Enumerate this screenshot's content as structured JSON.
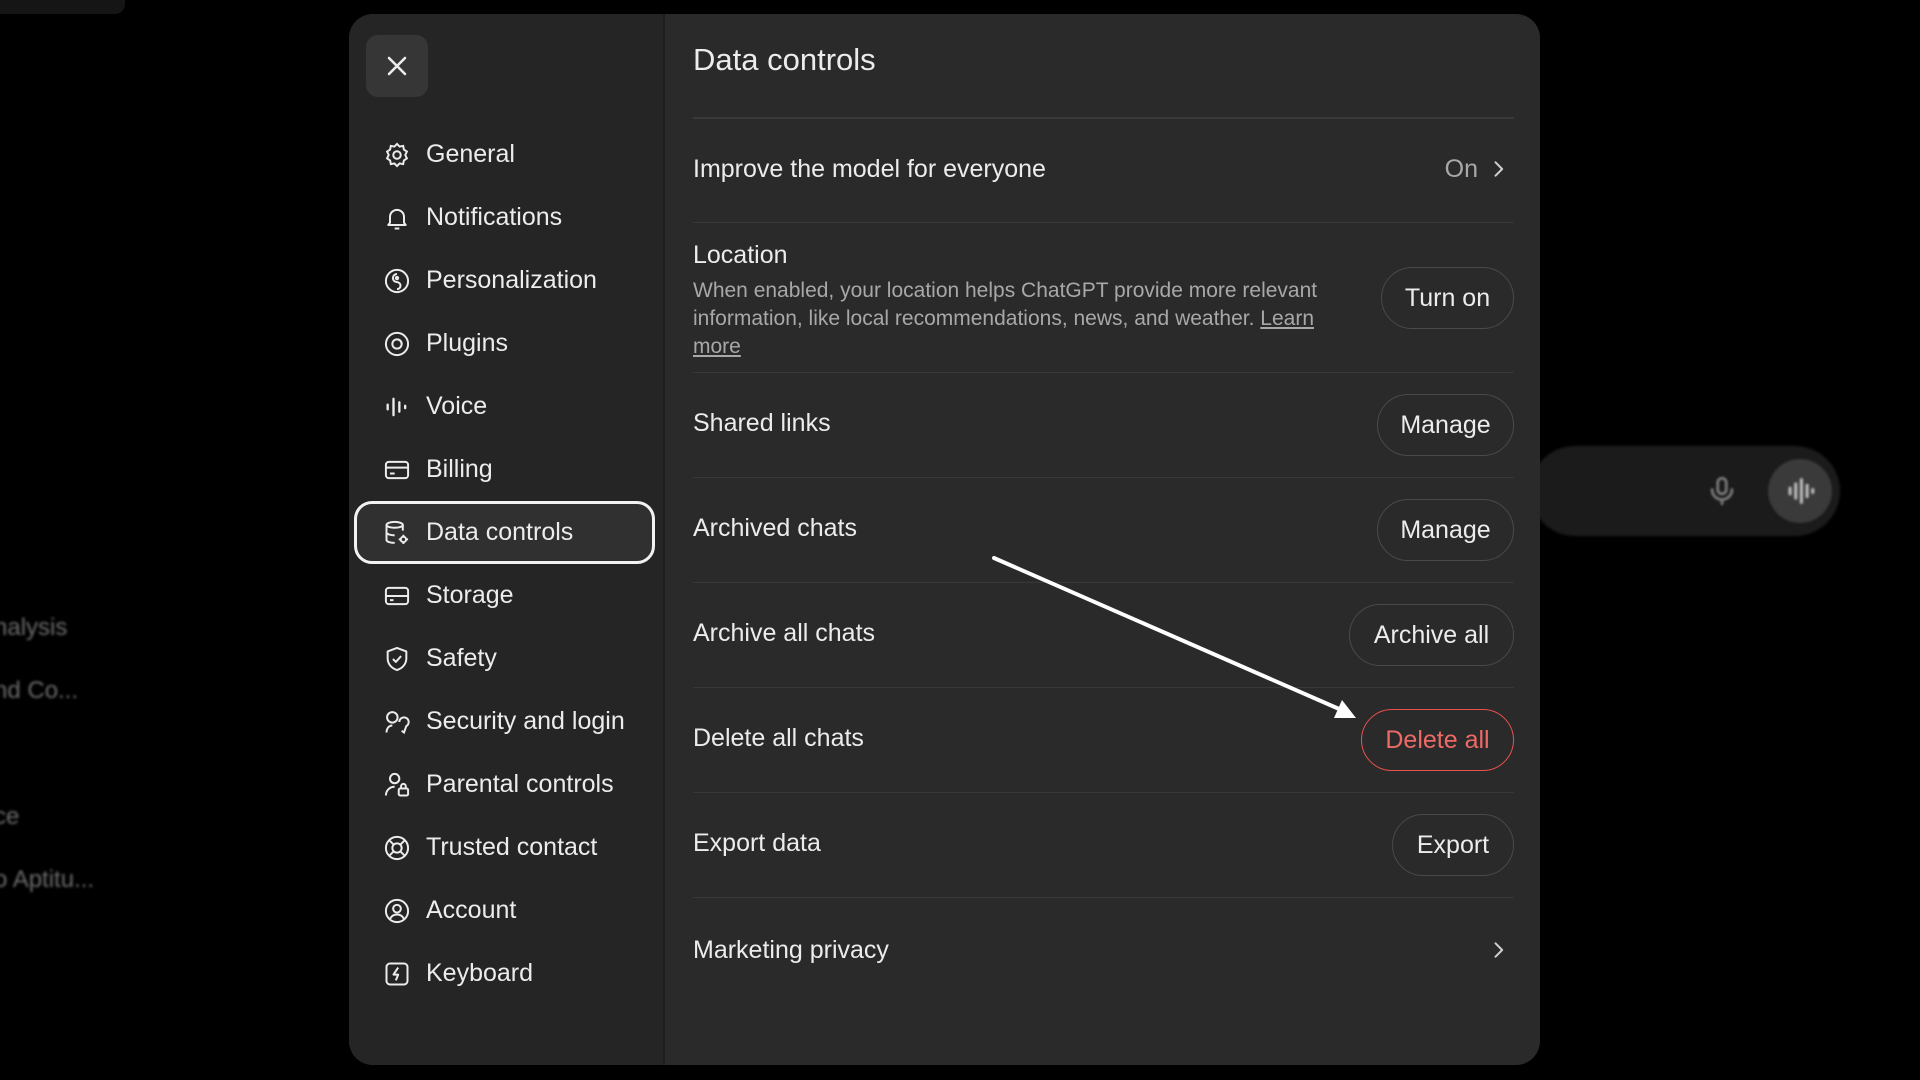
{
  "background": {
    "sidebar_items": [
      "nalysis",
      "nd Co...",
      "ce",
      "o Aptitu..."
    ]
  },
  "settings": {
    "close_label": "Close",
    "nav": [
      {
        "label": "General",
        "icon": "gear-icon"
      },
      {
        "label": "Notifications",
        "icon": "bell-icon"
      },
      {
        "label": "Personalization",
        "icon": "personalization-icon"
      },
      {
        "label": "Plugins",
        "icon": "plugins-icon"
      },
      {
        "label": "Voice",
        "icon": "voice-waveform-icon"
      },
      {
        "label": "Billing",
        "icon": "credit-card-icon"
      },
      {
        "label": "Data controls",
        "icon": "database-gear-icon",
        "active": true
      },
      {
        "label": "Storage",
        "icon": "storage-icon"
      },
      {
        "label": "Safety",
        "icon": "shield-icon"
      },
      {
        "label": "Security and login",
        "icon": "security-icon"
      },
      {
        "label": "Parental controls",
        "icon": "parental-icon"
      },
      {
        "label": "Trusted contact",
        "icon": "lifebuoy-icon"
      },
      {
        "label": "Account",
        "icon": "account-icon"
      },
      {
        "label": "Keyboard",
        "icon": "keyboard-icon"
      }
    ]
  },
  "data_controls": {
    "title": "Data controls",
    "improve_model": {
      "label": "Improve the model for everyone",
      "value": "On"
    },
    "location": {
      "label": "Location",
      "description": "When enabled, your location helps ChatGPT provide more relevant information, like local recommendations, news, and weather.",
      "link": "Learn more",
      "button": "Turn on"
    },
    "shared_links": {
      "label": "Shared links",
      "button": "Manage"
    },
    "archived_chats": {
      "label": "Archived chats",
      "button": "Manage"
    },
    "archive_all": {
      "label": "Archive all chats",
      "button": "Archive all"
    },
    "delete_all": {
      "label": "Delete all chats",
      "button": "Delete all",
      "color": "#e7514f"
    },
    "export": {
      "label": "Export data",
      "button": "Export"
    },
    "marketing": {
      "label": "Marketing privacy"
    }
  },
  "colors": {
    "modal_bg": "#2a2a2a",
    "sidebar_bg": "#252525",
    "danger": "#e7514f"
  }
}
